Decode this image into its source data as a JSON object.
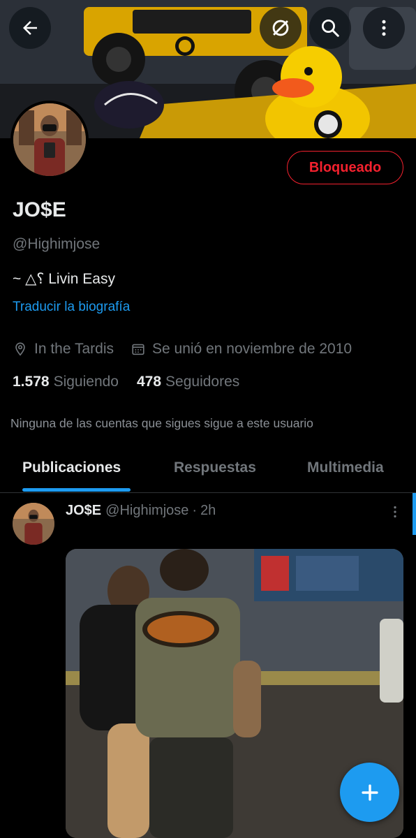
{
  "profile": {
    "name": "JO$E",
    "handle": "@Highimjose",
    "bio": "~ △⸮ Livin Easy",
    "translate_bio": "Traducir la biografía",
    "location": "In the Tardis",
    "joined": "Se unió en noviembre de 2010",
    "following_count": "1.578",
    "following_label": "Siguiendo",
    "followers_count": "478",
    "followers_label": "Seguidores",
    "mutual_note": "Ninguna de las cuentas que sigues sigue a este usuario",
    "blocked_label": "Bloqueado"
  },
  "tabs": [
    {
      "label": "Publicaciones",
      "active": true
    },
    {
      "label": "Respuestas",
      "active": false
    },
    {
      "label": "Multimedia",
      "active": false
    }
  ],
  "post": {
    "author_name": "JO$E",
    "author_handle": "@Highimjose",
    "separator": "·",
    "time": "2h"
  },
  "icons": {
    "back": "arrow-left-icon",
    "parody": "no-entry-icon",
    "search": "search-icon",
    "more": "more-vertical-icon",
    "location": "location-pin-icon",
    "calendar": "calendar-icon",
    "compose": "plus-icon"
  },
  "colors": {
    "accent": "#1d9bf0",
    "blocked": "#f4212e",
    "secondary_text": "#71767b"
  }
}
